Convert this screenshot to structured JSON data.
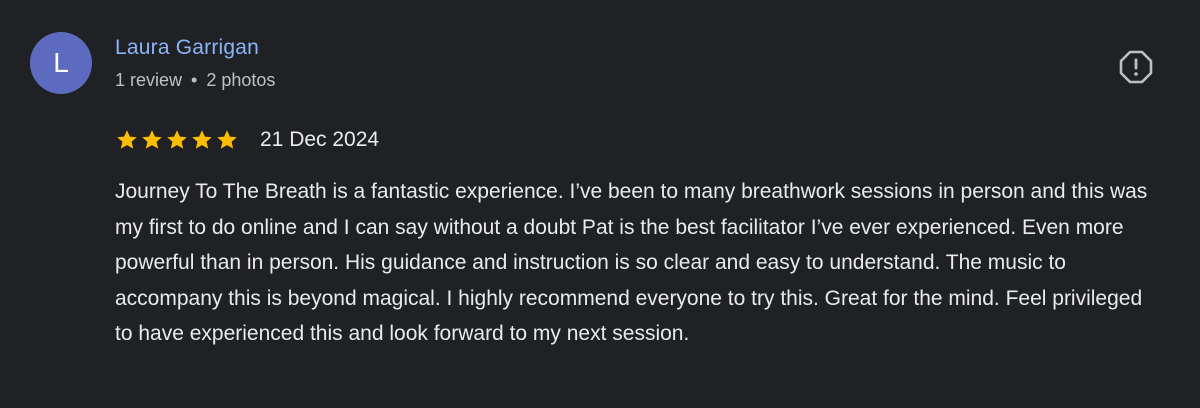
{
  "reviewer": {
    "initial": "L",
    "name": "Laura Garrigan",
    "review_count": "1 review",
    "separator": "•",
    "photo_count": "2 photos",
    "avatar_color": "#5c6bc0"
  },
  "review": {
    "rating": 5,
    "rating_max": 5,
    "date": "21 Dec 2024",
    "text": "Journey To The Breath is a fantastic experience. I’ve been to many breathwork sessions in person and this was my first to do online and I can say without a doubt Pat is the best facilitator I’ve ever experienced. Even more powerful than in person. His guidance and instruction is so clear and easy to understand. The music to accompany this is beyond magical. I highly recommend everyone to try this. Great for the mind. Feel privileged to have experienced this and look forward to my next session."
  },
  "icons": {
    "report": "report-icon",
    "star": "star-icon"
  },
  "colors": {
    "background": "#202124",
    "name_link": "#8ab4f8",
    "star": "#fbbc04",
    "text": "#e8eaed",
    "meta": "#bdc1c6"
  }
}
